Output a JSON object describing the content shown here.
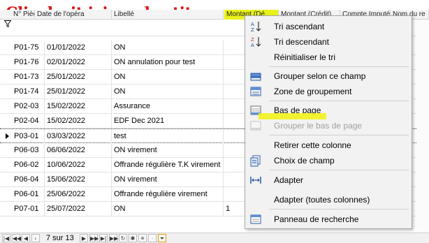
{
  "overlay": {
    "instruction": "Clic droit ici un des titres"
  },
  "header": {
    "columns": [
      "N° Pièce",
      "Date de l'opéra",
      "Libellé",
      "Montant (Dé",
      "Montant (Crédit)",
      "Compte Imputé",
      "Nom du re"
    ],
    "highlight_color": "#e9f21a"
  },
  "grid": {
    "rows": [
      {
        "piece": "P01-75",
        "date": "01/01/2022",
        "libelle": "ON",
        "extra": ""
      },
      {
        "piece": "P01-76",
        "date": "02/01/2022",
        "libelle": "ON annulation pour test",
        "extra": ""
      },
      {
        "piece": "P01-73",
        "date": "25/01/2022",
        "libelle": "ON",
        "extra": ""
      },
      {
        "piece": "P01-74",
        "date": "25/01/2022",
        "libelle": "ON",
        "extra": ""
      },
      {
        "piece": "P02-03",
        "date": "15/02/2022",
        "libelle": "Assurance",
        "extra": ""
      },
      {
        "piece": "P02-04",
        "date": "15/02/2022",
        "libelle": "EDF Dec 2021",
        "extra": ""
      },
      {
        "piece": "P03-01",
        "date": "03/03/2022",
        "libelle": "test",
        "extra": ""
      },
      {
        "piece": "P06-03",
        "date": "06/06/2022",
        "libelle": "ON virement",
        "extra": ""
      },
      {
        "piece": "P06-02",
        "date": "10/06/2022",
        "libelle": "Offrande régulière T.K virement",
        "extra": ""
      },
      {
        "piece": "P06-04",
        "date": "15/06/2022",
        "libelle": "ON  virement",
        "extra": ""
      },
      {
        "piece": "P06-01",
        "date": "25/06/2022",
        "libelle": "Offrande régulière  virement",
        "extra": ""
      },
      {
        "piece": "P07-01",
        "date": "25/07/2022",
        "libelle": "ON",
        "extra": "1"
      }
    ],
    "current_row_index": 6
  },
  "menu": {
    "items": [
      {
        "label": "Tri ascendant",
        "icon": "sort-ascending-icon",
        "disabled": false
      },
      {
        "label": "Tri descendant",
        "icon": "sort-descending-icon",
        "disabled": false
      },
      {
        "label": "Réinitialiser le tri",
        "icon": "",
        "disabled": false
      },
      {
        "label": "Grouper selon ce champ",
        "icon": "group-by-icon",
        "disabled": false
      },
      {
        "label": "Zone de groupement",
        "icon": "group-panel-icon",
        "disabled": false
      },
      {
        "label": "Bas de page",
        "icon": "footer-icon",
        "disabled": false
      },
      {
        "label": "Grouper le bas de page",
        "icon": "group-footer-icon",
        "disabled": true
      },
      {
        "label": "Retirer cette colonne",
        "icon": "",
        "disabled": false
      },
      {
        "label": "Choix de champ",
        "icon": "field-chooser-icon",
        "disabled": false
      },
      {
        "label": "Adapter",
        "icon": "best-fit-icon",
        "disabled": false
      },
      {
        "label": "Adapter (toutes colonnes)",
        "icon": "",
        "disabled": false
      },
      {
        "label": "Panneau de recherche",
        "icon": "find-panel-icon",
        "disabled": false
      }
    ]
  },
  "navigator": {
    "position_text": "7 sur 13"
  },
  "colors": {
    "overlay_text": "#e01010",
    "marker": "#f3f21b"
  }
}
